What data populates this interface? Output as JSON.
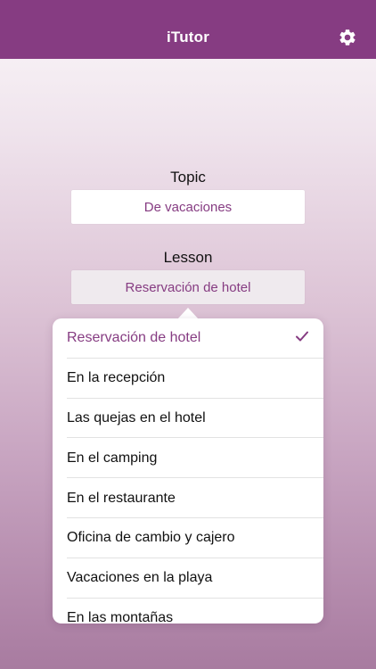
{
  "app": {
    "title": "iTutor"
  },
  "icons": {
    "settings": "gear-icon",
    "selected_mark": "checkmark-icon"
  },
  "colors": {
    "accent": "#863c82",
    "nav_background": "#863c82"
  },
  "topic": {
    "label": "Topic",
    "value": "De vacaciones"
  },
  "lesson": {
    "label": "Lesson",
    "value": "Reservación de hotel"
  },
  "lesson_options": [
    {
      "label": "Reservación de hotel",
      "selected": true
    },
    {
      "label": "En la recepción",
      "selected": false
    },
    {
      "label": "Las quejas en el hotel",
      "selected": false
    },
    {
      "label": "En el camping",
      "selected": false
    },
    {
      "label": "En el restaurante",
      "selected": false
    },
    {
      "label": "Oficina de cambio y cajero",
      "selected": false
    },
    {
      "label": "Vacaciones en la playa",
      "selected": false
    },
    {
      "label": "En las montañas",
      "selected": false
    }
  ]
}
